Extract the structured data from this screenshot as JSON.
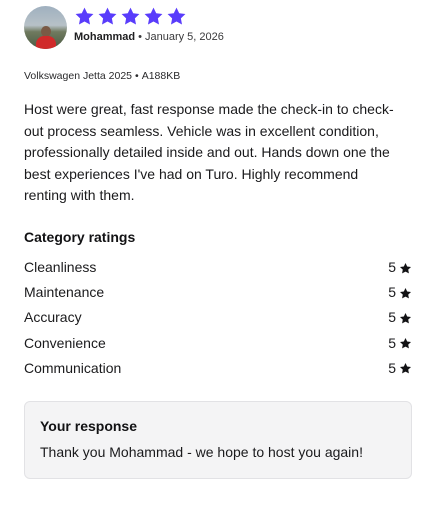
{
  "review": {
    "reviewer_name": "Mohammad",
    "date": "January 5, 2026",
    "separator": "•",
    "rating": 5,
    "star_color": "#593CFB",
    "vehicle": "Volkswagen Jetta 2025",
    "plate": "A188KB",
    "text": "Host were great, fast response made the check-in to check-out process seamless. Vehicle was in excellent condition, professionally detailed inside and out. Hands down one the best experiences I've had on Turo. Highly recommend renting with them."
  },
  "category_ratings": {
    "title": "Category ratings",
    "items": [
      {
        "label": "Cleanliness",
        "score": "5",
        "icon": "star-icon"
      },
      {
        "label": "Maintenance",
        "score": "5",
        "icon": "star-icon"
      },
      {
        "label": "Accuracy",
        "score": "5",
        "icon": "star-icon"
      },
      {
        "label": "Convenience",
        "score": "5",
        "icon": "star-icon"
      },
      {
        "label": "Communication",
        "score": "5",
        "icon": "star-icon"
      }
    ]
  },
  "response": {
    "title": "Your response",
    "text": "Thank you Mohammad - we hope to host you again!"
  }
}
